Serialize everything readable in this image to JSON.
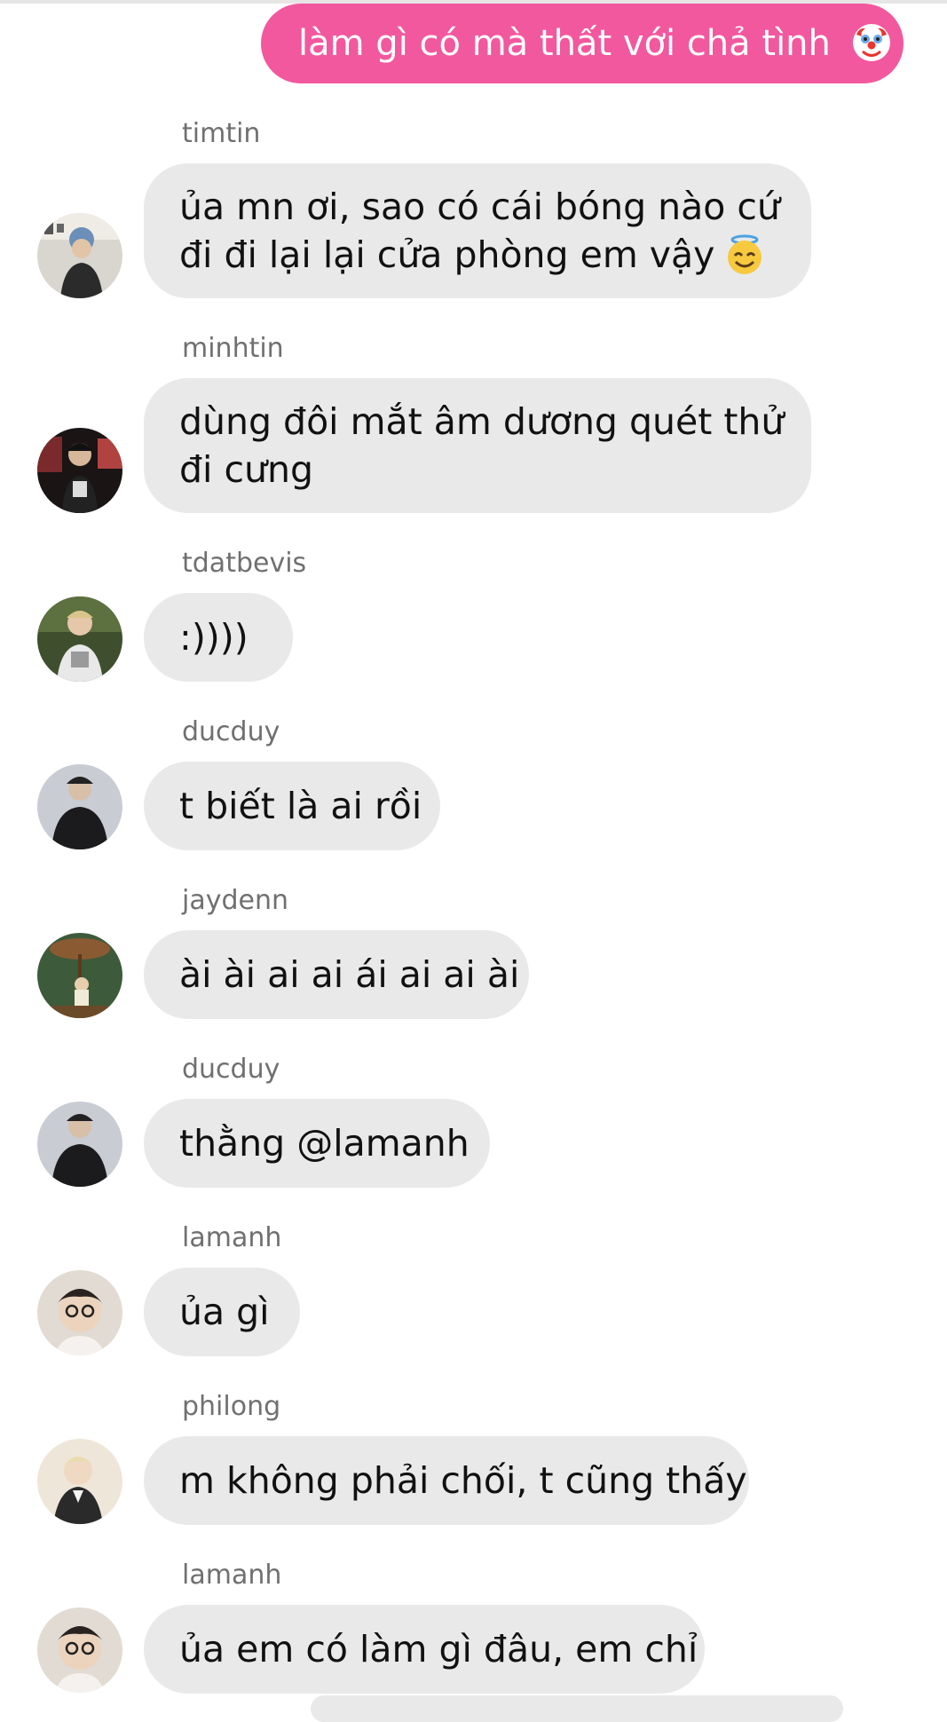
{
  "sent_message": {
    "text": "làm gì có mà thất với chả tình",
    "emoji": "clown-face",
    "color": "#f2589e"
  },
  "messages": [
    {
      "sender": "timtin",
      "lines": [
        "ủa mn ơi, sao có cái bóng nào cứ",
        "đi đi lại lại cửa phòng em vậy"
      ],
      "emoji": "smiling-face-with-halo"
    },
    {
      "sender": "minhtin",
      "lines": [
        "dùng đôi mắt âm dương quét thử",
        "đi cưng"
      ]
    },
    {
      "sender": "tdatbevis",
      "lines": [
        ":))))"
      ]
    },
    {
      "sender": "ducduy",
      "lines": [
        "t biết là ai rồi"
      ]
    },
    {
      "sender": "jaydenn",
      "lines": [
        "ài ài ai ai ái ai ai ài"
      ]
    },
    {
      "sender": "ducduy",
      "lines": [
        "thằng @lamanh"
      ]
    },
    {
      "sender": "lamanh",
      "lines": [
        "ủa gì"
      ]
    },
    {
      "sender": "philong",
      "lines": [
        "m không phải chối, t cũng thấy"
      ]
    },
    {
      "sender": "lamanh",
      "lines": [
        "ủa em có làm gì đâu, em chỉ"
      ]
    }
  ],
  "colors": {
    "received_bubble": "#e9e9e9",
    "sender_name": "#707070",
    "message_text": "#111111"
  }
}
